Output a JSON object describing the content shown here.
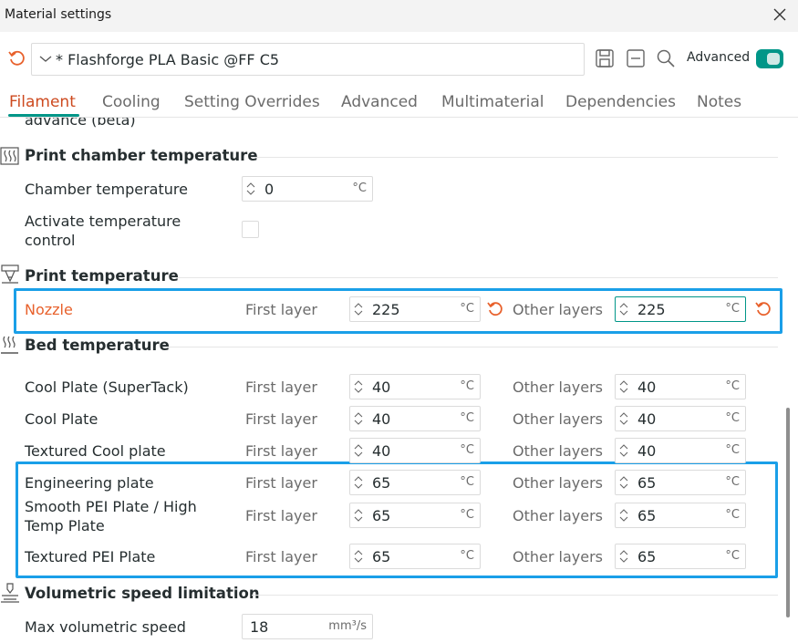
{
  "window": {
    "title": "Material settings"
  },
  "toolbar": {
    "preset_name": "* Flashforge PLA Basic @FF C5",
    "advanced_label": "Advanced",
    "advanced_on": true
  },
  "tabs": [
    {
      "label": "Filament",
      "active": true
    },
    {
      "label": "Cooling"
    },
    {
      "label": "Setting Overrides"
    },
    {
      "label": "Advanced"
    },
    {
      "label": "Multimaterial"
    },
    {
      "label": "Dependencies"
    },
    {
      "label": "Notes"
    }
  ],
  "cut_off_text": "advance (beta)",
  "sections": {
    "chamber": {
      "title": "Print chamber temperature",
      "chamber_temp_label": "Chamber temperature",
      "chamber_temp_value": "0",
      "unit": "°C",
      "activate_label": "Activate temperature control",
      "activate_checked": false
    },
    "print_temp": {
      "title": "Print temperature",
      "nozzle_label": "Nozzle",
      "first_layer_label": "First layer",
      "other_layers_label": "Other layers",
      "first_value": "225",
      "other_value": "225",
      "unit": "°C"
    },
    "bed_temp": {
      "title": "Bed temperature",
      "first_layer_label": "First layer",
      "other_layers_label": "Other layers",
      "unit": "°C",
      "rows": [
        {
          "label": "Cool Plate (SuperTack)",
          "first": "40",
          "other": "40"
        },
        {
          "label": "Cool Plate",
          "first": "40",
          "other": "40"
        },
        {
          "label": "Textured Cool plate",
          "first": "40",
          "other": "40"
        },
        {
          "label": "Engineering plate",
          "first": "65",
          "other": "65"
        },
        {
          "label": "Smooth PEI Plate / High Temp Plate",
          "first": "65",
          "other": "65"
        },
        {
          "label": "Textured PEI Plate",
          "first": "65",
          "other": "65"
        }
      ]
    },
    "volumetric": {
      "title": "Volumetric speed limitation",
      "max_label": "Max volumetric speed",
      "max_value": "18",
      "unit": "mm³/s"
    }
  },
  "colors": {
    "accent": "#009688",
    "modified": "#e8612c",
    "highlight": "#1a9fe8"
  }
}
